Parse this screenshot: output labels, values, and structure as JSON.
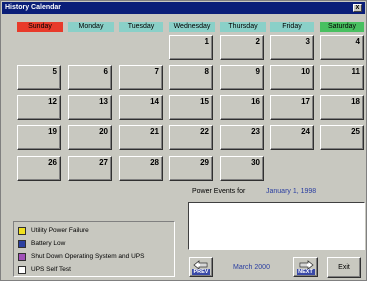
{
  "window": {
    "title": "History Calendar",
    "close_glyph": "x"
  },
  "weekdays": [
    {
      "label": "Sunday",
      "color": "#e83a2a"
    },
    {
      "label": "Monday",
      "color": "#8ad0c8"
    },
    {
      "label": "Tuesday",
      "color": "#8ad0c8"
    },
    {
      "label": "Wednesday",
      "color": "#8ad0c8"
    },
    {
      "label": "Thursday",
      "color": "#8ad0c8"
    },
    {
      "label": "Friday",
      "color": "#8ad0c8"
    },
    {
      "label": "Saturday",
      "color": "#48c060"
    }
  ],
  "calendar": {
    "days": [
      "1",
      "2",
      "3",
      "4",
      "5",
      "6",
      "7",
      "8",
      "9",
      "10",
      "11",
      "12",
      "13",
      "14",
      "15",
      "16",
      "17",
      "18",
      "19",
      "20",
      "21",
      "22",
      "23",
      "24",
      "25",
      "26",
      "27",
      "28",
      "29",
      "30"
    ]
  },
  "legend": [
    {
      "label": "Utility Power Failure",
      "color": "#f0e020"
    },
    {
      "label": "Battery Low",
      "color": "#2a3ea0"
    },
    {
      "label": "Shut Down Operating System and UPS",
      "color": "#a050b8"
    },
    {
      "label": "UPS Self Test",
      "color": "#ffffff"
    }
  ],
  "power_events": {
    "label": "Power Events for",
    "date": "January 1, 1998"
  },
  "nav": {
    "prev_label": "PREV",
    "next_label": "NEXT",
    "month": "March 2000",
    "exit_label": "Exit"
  },
  "icons": {
    "close": "close-icon",
    "prev": "hand-left-icon",
    "next": "hand-right-icon"
  }
}
